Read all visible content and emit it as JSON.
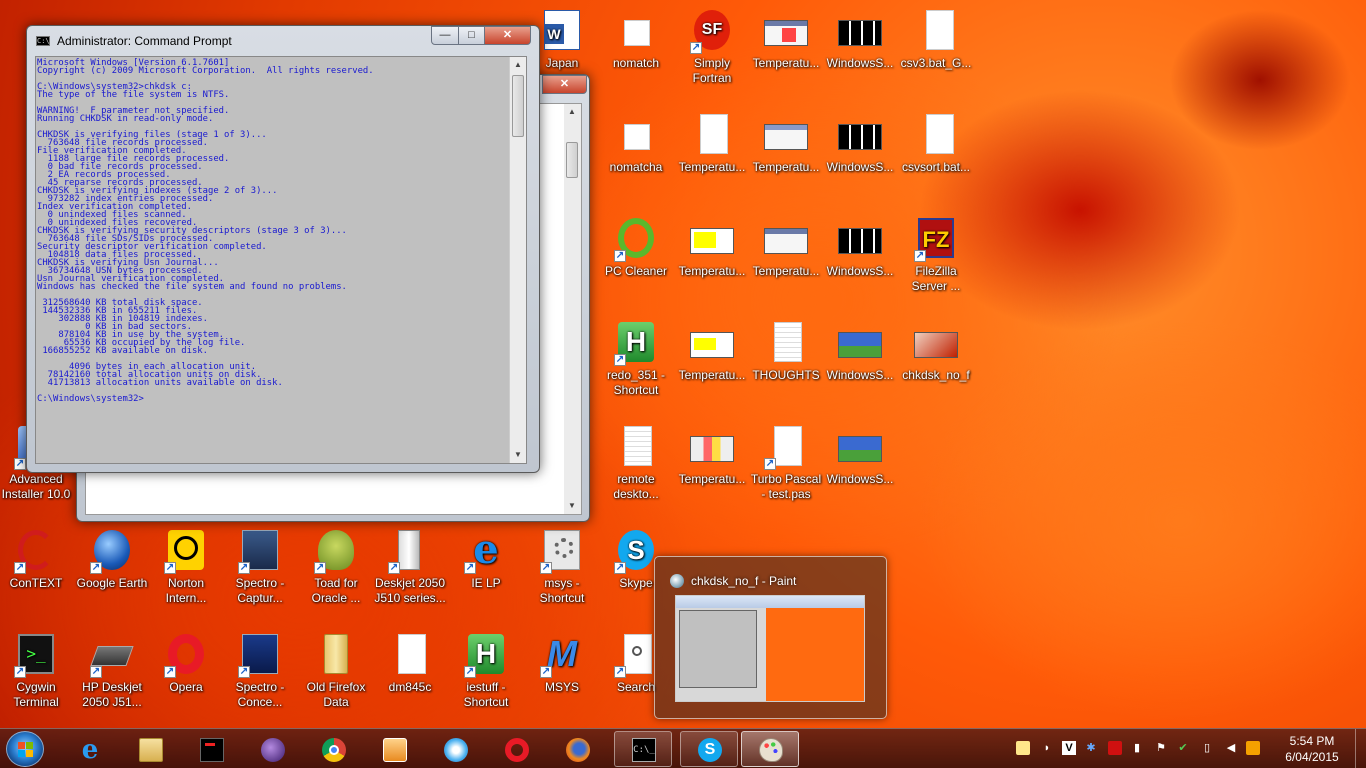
{
  "desktop_icons": [
    {
      "label": "Japan",
      "kind": "word"
    },
    {
      "label": "nomatch",
      "kind": "file"
    },
    {
      "label": "Simply Fortran",
      "kind": "fortran"
    },
    {
      "label": "Temperatu...",
      "kind": "thumb"
    },
    {
      "label": "WindowsS...",
      "kind": "thumbdark"
    },
    {
      "label": "csv3.bat_G...",
      "kind": "file"
    },
    {
      "label": "nomatcha",
      "kind": "file"
    },
    {
      "label": "Temperatu...",
      "kind": "file"
    },
    {
      "label": "Temperatu...",
      "kind": "thumb"
    },
    {
      "label": "WindowsS...",
      "kind": "thumbdark"
    },
    {
      "label": "csvsort.bat...",
      "kind": "file"
    },
    {
      "label": "PC Cleaner",
      "kind": "pccleaner"
    },
    {
      "label": "Temperatu...",
      "kind": "thumbyellow"
    },
    {
      "label": "Temperatu...",
      "kind": "thumb"
    },
    {
      "label": "WindowsS...",
      "kind": "thumbdark"
    },
    {
      "label": "FileZilla Server ...",
      "kind": "filezilla"
    },
    {
      "label": "redo_351 - Shortcut",
      "kind": "greenh"
    },
    {
      "label": "Temperatu...",
      "kind": "thumbyellow"
    },
    {
      "label": "THOUGHTS",
      "kind": "file"
    },
    {
      "label": "WindowsS...",
      "kind": "thumbxp"
    },
    {
      "label": "chkdsk_no_f",
      "kind": "thumbred"
    },
    {
      "label": "remote deskto...",
      "kind": "file"
    },
    {
      "label": "Temperatu...",
      "kind": "thumb"
    },
    {
      "label": "Turbo Pascal - test.pas",
      "kind": "file"
    },
    {
      "label": "WindowsS...",
      "kind": "thumbxp"
    },
    {
      "label": "Advanced Installer 10.0",
      "kind": "installer"
    },
    {
      "label": "ConTEXT",
      "kind": "context"
    },
    {
      "label": "Google Earth",
      "kind": "earth"
    },
    {
      "label": "Norton Intern...",
      "kind": "norton"
    },
    {
      "label": "Spectro - Captur...",
      "kind": "spectro"
    },
    {
      "label": "Toad for Oracle ...",
      "kind": "toad"
    },
    {
      "label": "Deskjet 2050 J510 series...",
      "kind": "printer"
    },
    {
      "label": "IE LP",
      "kind": "ie"
    },
    {
      "label": "msys - Shortcut",
      "kind": "gear"
    },
    {
      "label": "Skype",
      "kind": "skype"
    },
    {
      "label": "Cygwin Terminal",
      "kind": "cygwin"
    },
    {
      "label": "HP Deskjet 2050 J51...",
      "kind": "scanner"
    },
    {
      "label": "Opera",
      "kind": "opera"
    },
    {
      "label": "Spectro - Conce...",
      "kind": "concept"
    },
    {
      "label": "Old Firefox Data",
      "kind": "folder"
    },
    {
      "label": "dm845c",
      "kind": "file"
    },
    {
      "label": "iestuff - Shortcut",
      "kind": "greenh"
    },
    {
      "label": "MSYS",
      "kind": "msys"
    },
    {
      "label": "Search",
      "kind": "search"
    }
  ],
  "cmd_window": {
    "title": "Administrator: Command Prompt",
    "min": "—",
    "max": "□",
    "close": "✕",
    "console_lines": [
      "Microsoft Windows [Version 6.1.7601]",
      "Copyright (c) 2009 Microsoft Corporation.  All rights reserved.",
      "",
      "C:\\Windows\\system32>chkdsk c:",
      "The type of the file system is NTFS.",
      "",
      "WARNING!  F parameter not specified.",
      "Running CHKDSK in read-only mode.",
      "",
      "CHKDSK is verifying files (stage 1 of 3)...",
      "  763648 file records processed.",
      "File verification completed.",
      "  1188 large file records processed.",
      "  0 bad file records processed.",
      "  2 EA records processed.",
      "  45 reparse records processed.",
      "CHKDSK is verifying indexes (stage 2 of 3)...",
      "  973282 index entries processed.",
      "Index verification completed.",
      "  0 unindexed files scanned.",
      "  0 unindexed files recovered.",
      "CHKDSK is verifying security descriptors (stage 3 of 3)...",
      "  763648 file SDs/SIDs processed.",
      "Security descriptor verification completed.",
      "  104818 data files processed.",
      "CHKDSK is verifying Usn Journal...",
      "  36734648 USN bytes processed.",
      "Usn Journal verification completed.",
      "Windows has checked the file system and found no problems.",
      "",
      " 312568640 KB total disk space.",
      " 144532336 KB in 655211 files.",
      "    302888 KB in 104819 indexes.",
      "         0 KB in bad sectors.",
      "    878104 KB in use by the system.",
      "     65536 KB occupied by the log file.",
      " 166855252 KB available on disk.",
      "",
      "      4096 bytes in each allocation unit.",
      "  78142160 total allocation units on disk.",
      "  41713813 allocation units available on disk.",
      "",
      "C:\\Windows\\system32>"
    ]
  },
  "bg_window": {
    "close": "✕"
  },
  "scroll": {
    "up": "▲",
    "down": "▼"
  },
  "preview": {
    "title": "chkdsk_no_f - Paint"
  },
  "taskbar": {
    "items": [
      {
        "name": "ie",
        "state": "pinned"
      },
      {
        "name": "explorer",
        "state": "pinned"
      },
      {
        "name": "terminal-app",
        "state": "pinned"
      },
      {
        "name": "eclipse",
        "state": "pinned"
      },
      {
        "name": "chrome",
        "state": "pinned"
      },
      {
        "name": "media-player",
        "state": "pinned"
      },
      {
        "name": "safari",
        "state": "pinned"
      },
      {
        "name": "opera",
        "state": "pinned"
      },
      {
        "name": "firefox",
        "state": "pinned"
      },
      {
        "name": "command-prompt",
        "state": "run"
      },
      {
        "name": "skype",
        "state": "run"
      },
      {
        "name": "paint",
        "state": "active"
      }
    ],
    "clock_time": "5:54 PM",
    "clock_date": "6/04/2015"
  }
}
